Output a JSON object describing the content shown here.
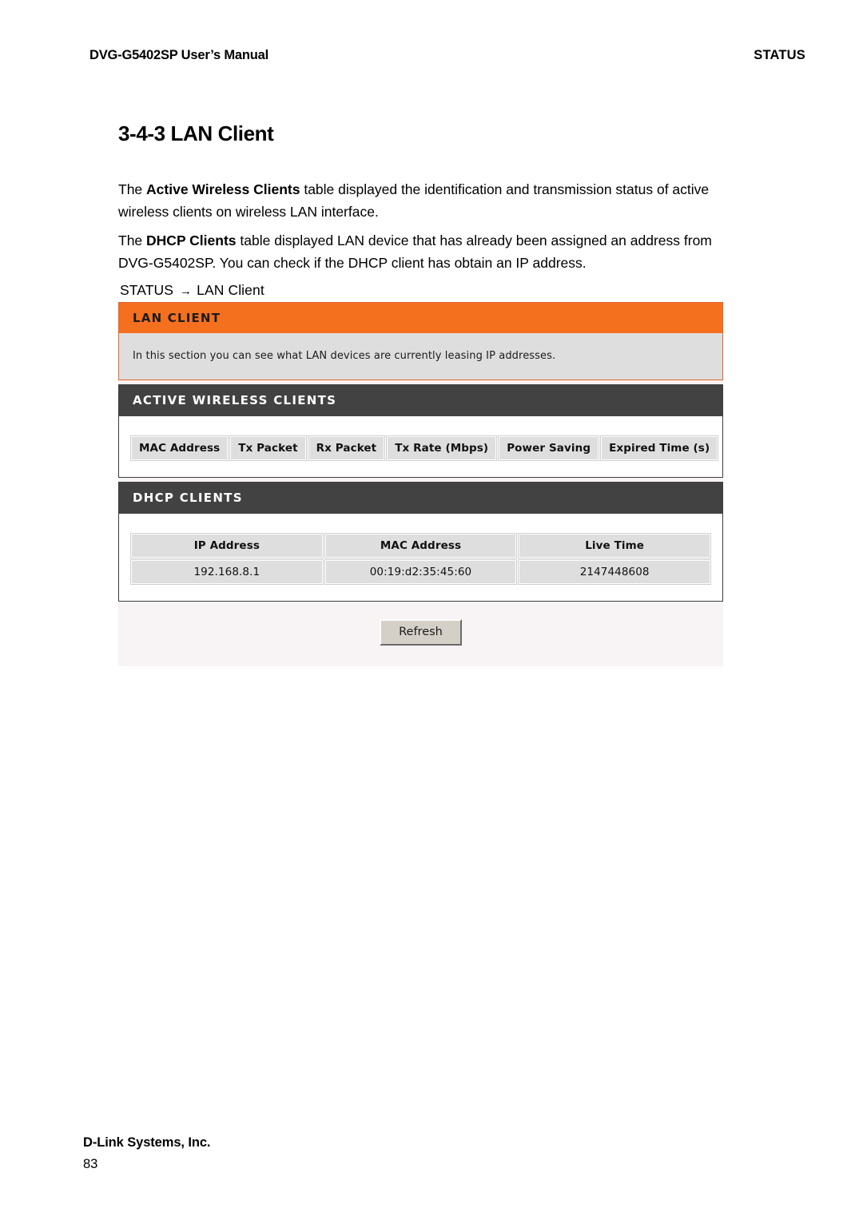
{
  "page_header": {
    "left": "DVG-G5402SP User’s Manual",
    "right": "STATUS"
  },
  "section": {
    "heading": "3-4-3 LAN Client",
    "paragraph_1": {
      "before": "The ",
      "bold": "Active Wireless Clients",
      "after": " table displayed the identification and transmission status of active wireless clients on wireless LAN interface."
    },
    "paragraph_2": {
      "before": "The ",
      "bold": "DHCP Clients",
      "after": " table displayed LAN device that has already been assigned an address from DVG-G5402SP. You can check if the DHCP client has obtain an IP address."
    }
  },
  "breadcrumb": {
    "root": "STATUS",
    "arrow": "→",
    "current": "LAN Client"
  },
  "router_ui": {
    "lan_client_panel": {
      "title": "LAN CLIENT",
      "description": "In this section you can see what LAN devices are currently leasing IP addresses.",
      "header_color": "#f4701f",
      "body_color": "#dedede"
    },
    "active_wireless_clients": {
      "title": "ACTIVE WIRELESS CLIENTS",
      "header_color": "#424242",
      "columns": [
        "MAC Address",
        "Tx Packet",
        "Rx Packet",
        "Tx Rate (Mbps)",
        "Power Saving",
        "Expired Time (s)"
      ],
      "rows": []
    },
    "dhcp_clients": {
      "title": "DHCP CLIENTS",
      "header_color": "#424242",
      "columns": [
        "IP Address",
        "MAC Address",
        "Live Time"
      ],
      "rows": [
        [
          "192.168.8.1",
          "00:19:d2:35:45:60",
          "2147448608"
        ]
      ]
    },
    "refresh_button": "Refresh"
  },
  "page_footer": {
    "company": "D-Link Systems, Inc.",
    "page_number": "83"
  }
}
